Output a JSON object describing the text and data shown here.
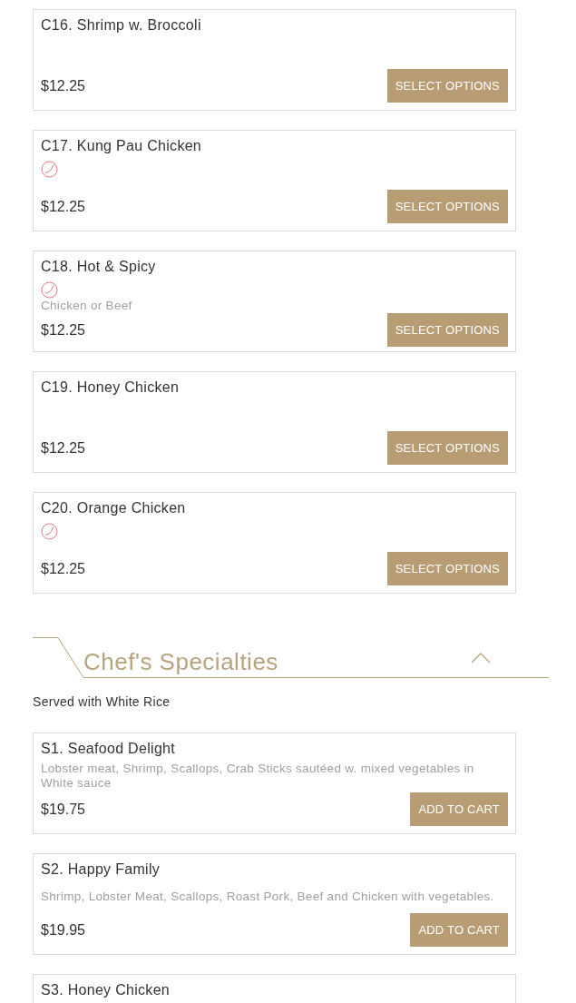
{
  "items_top": [
    {
      "title": "C16. Shrimp w. Broccoli",
      "spicy": false,
      "price": "$12.25",
      "button": "SELECT OPTIONS"
    },
    {
      "title": "C17. Kung Pau Chicken",
      "spicy": true,
      "price": "$12.25",
      "button": "SELECT OPTIONS"
    },
    {
      "title": "C18. Hot & Spicy",
      "spicy": true,
      "description": "Chicken or Beef",
      "price": "$12.25",
      "button": "SELECT OPTIONS"
    },
    {
      "title": "C19. Honey Chicken",
      "spicy": false,
      "price": "$12.25",
      "button": "SELECT OPTIONS"
    },
    {
      "title": "C20. Orange Chicken",
      "spicy": true,
      "price": "$12.25",
      "button": "SELECT OPTIONS"
    }
  ],
  "section": {
    "title": "Chef's Specialties",
    "expanded": true,
    "subtitle": "Served with White Rice",
    "items": [
      {
        "title": "S1. Seafood Delight",
        "spicy": false,
        "description": "Lobster meat, Shrimp, Scallops, Crab Sticks sautéed w. mixed vegetables in White sauce",
        "price": "$19.75",
        "button": "ADD TO CART"
      },
      {
        "title": "S2. Happy Family",
        "spicy": false,
        "description": "Shrimp, Lobster Meat, Scallops, Roast Pork, Beef and Chicken with vegetables.",
        "price": "$19.95",
        "button": "ADD TO CART"
      },
      {
        "title": "S3. Honey Chicken"
      }
    ]
  }
}
